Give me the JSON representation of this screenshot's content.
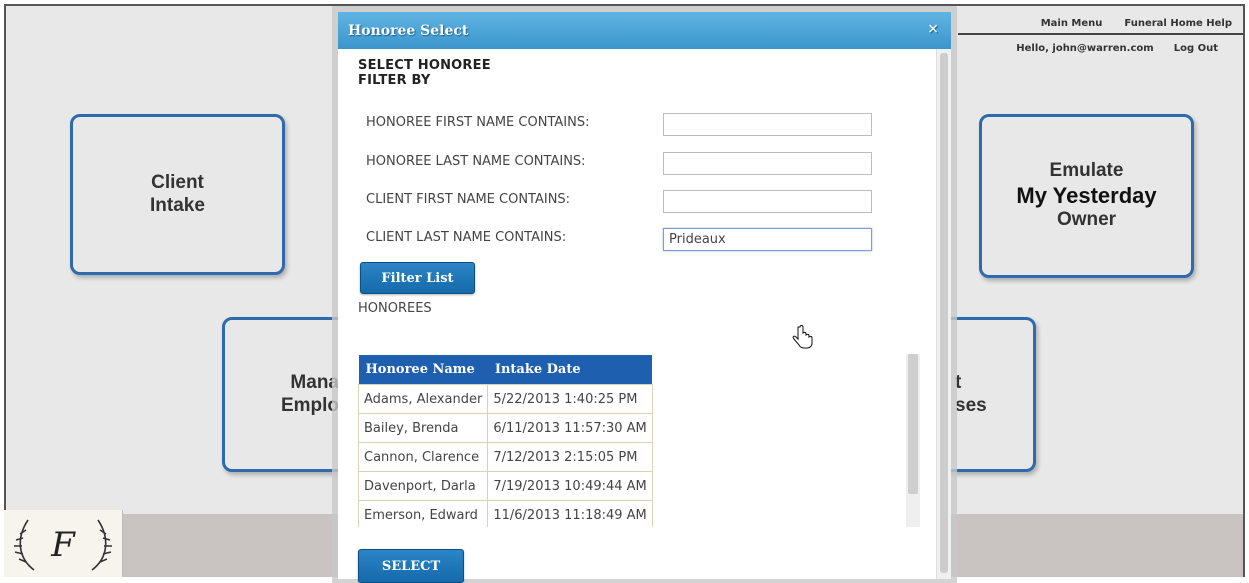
{
  "top_nav": {
    "main_menu": "Main Menu",
    "help": "Funeral Home Help",
    "greeting": "Hello, john@warren.com",
    "logout": "Log Out"
  },
  "tiles": {
    "client_intake": [
      "Client",
      "Intake"
    ],
    "emulate": [
      "Emulate",
      "My Yesterday",
      "Owner"
    ],
    "manage_left": [
      "Mana",
      "Emplo"
    ],
    "manage_right": [
      "t",
      "ses"
    ]
  },
  "dialog": {
    "title": "Honoree Select",
    "close": "×",
    "select_honoree": "SELECT HONOREE",
    "filter_by": "FILTER BY",
    "filters": [
      {
        "label": "HONOREE FIRST NAME CONTAINS:",
        "value": ""
      },
      {
        "label": "HONOREE LAST NAME CONTAINS:",
        "value": ""
      },
      {
        "label": "CLIENT FIRST NAME CONTAINS:",
        "value": ""
      },
      {
        "label": "CLIENT LAST NAME CONTAINS:",
        "value": "Prideaux"
      }
    ],
    "filter_button": "Filter List",
    "honorees_label": "HONOREES",
    "columns": [
      "Honoree Name",
      "Intake Date"
    ],
    "rows": [
      [
        "Adams, Alexander",
        "5/22/2013 1:40:25 PM"
      ],
      [
        "Bailey, Brenda",
        "6/11/2013 11:57:30 AM"
      ],
      [
        "Cannon, Clarence",
        "7/12/2013 2:15:05 PM"
      ],
      [
        "Davenport, Darla",
        "7/19/2013 10:49:44 AM"
      ],
      [
        "Emerson, Edward",
        "11/6/2013 11:18:49 AM"
      ]
    ],
    "select_button": "SELECT"
  },
  "colors": {
    "accent": "#2e6aad",
    "title_bar": "#4aa3d8",
    "table_header": "#1f5fb0"
  }
}
